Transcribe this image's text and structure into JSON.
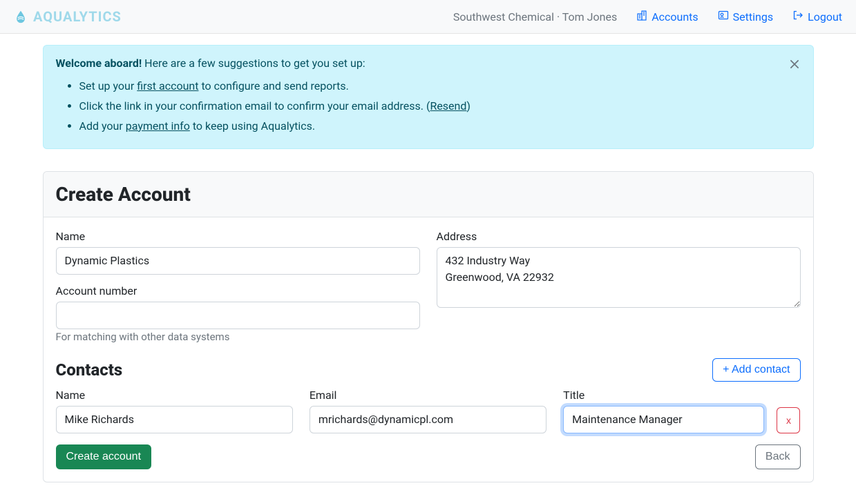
{
  "brand": {
    "name": "AQUALYTICS"
  },
  "nav": {
    "org_user": "Southwest Chemical · Tom Jones",
    "accounts": "Accounts",
    "settings": "Settings",
    "logout": "Logout"
  },
  "alert": {
    "heading_strong": "Welcome aboard!",
    "heading_rest": " Here are a few suggestions to get you set up:",
    "items": {
      "i1_prefix": "Set up your ",
      "i1_link": "first account",
      "i1_suffix": " to configure and send reports.",
      "i2_prefix": "Click the link in your confirmation email to confirm your email address. (",
      "i2_link": "Resend",
      "i2_suffix": ")",
      "i3_prefix": "Add your ",
      "i3_link": "payment info",
      "i3_suffix": " to keep using Aqualytics."
    }
  },
  "panel": {
    "title": "Create Account",
    "labels": {
      "name": "Name",
      "account_number": "Account number",
      "address": "Address"
    },
    "values": {
      "name": "Dynamic Plastics",
      "account_number": "",
      "address": "432 Industry Way\nGreenwood, VA 22932"
    },
    "help": {
      "account_number": "For matching with other data systems"
    },
    "contacts_title": "Contacts",
    "add_contact": "+ Add contact",
    "contact_labels": {
      "name": "Name",
      "email": "Email",
      "title": "Title"
    },
    "contacts": [
      {
        "name": "Mike Richards",
        "email": "mrichards@dynamicpl.com",
        "title": "Maintenance Manager"
      }
    ],
    "remove_label": "x",
    "create_btn": "Create account",
    "back_btn": "Back"
  }
}
